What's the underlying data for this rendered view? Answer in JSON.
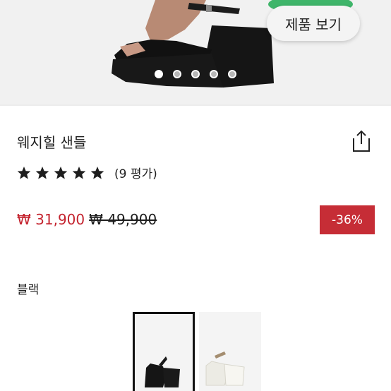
{
  "hero": {
    "view_product_label": "제품 보기",
    "slide_count": 5,
    "active_slide": 1
  },
  "product": {
    "title": "웨지힐 샌들",
    "rating_stars": 5,
    "review_count_label": "(9 평가)",
    "sale_price": "₩ 31,900",
    "original_price": "₩ 49,900",
    "discount": "-36%"
  },
  "colors": {
    "label": "블랙",
    "swatches": [
      {
        "name": "black",
        "selected": true
      },
      {
        "name": "white",
        "selected": false
      }
    ]
  },
  "palette": {
    "sale_red": "#c4242f",
    "badge_red": "#c62d36",
    "view_button_bg": "#f4f4f4",
    "view_button_glow": "#3fb56a"
  },
  "icons": {
    "share": "share-icon",
    "star": "star-icon"
  }
}
